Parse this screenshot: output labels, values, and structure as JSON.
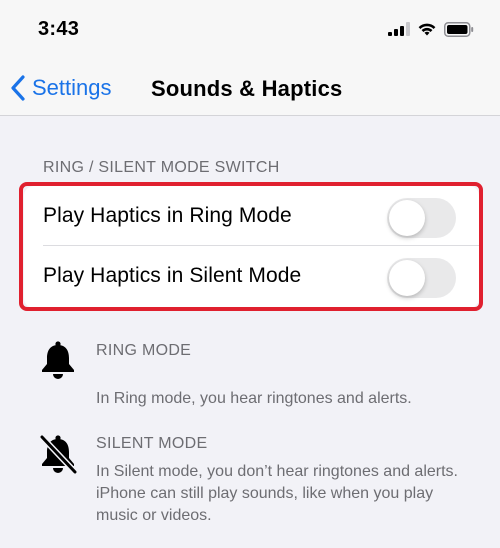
{
  "status": {
    "time": "3:43",
    "icons": [
      "cellular-signal-icon",
      "wifi-icon",
      "battery-icon"
    ]
  },
  "nav": {
    "back_label": "Settings",
    "title": "Sounds & Haptics"
  },
  "section": {
    "header": "RING / SILENT MODE SWITCH",
    "rows": [
      {
        "label": "Play Haptics in Ring Mode",
        "toggle_on": false
      },
      {
        "label": "Play Haptics in Silent Mode",
        "toggle_on": false
      }
    ]
  },
  "modes": {
    "ring": {
      "title": "RING MODE",
      "description": "In Ring mode, you hear ringtones and alerts."
    },
    "silent": {
      "title": "SILENT MODE",
      "description": "In Silent mode, you don’t hear ringtones and alerts. iPhone can still play sounds, like when you play music or videos."
    }
  },
  "colors": {
    "accent": "#1a73e8",
    "highlight": "#e0202f",
    "toggle_off": "#e9e9ea",
    "background": "#f2f2f7"
  }
}
